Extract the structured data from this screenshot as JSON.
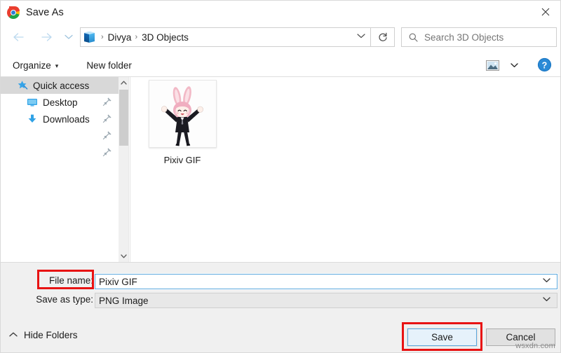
{
  "window": {
    "title": "Save As",
    "app_icon": "chrome-icon",
    "close_label": "✕"
  },
  "nav": {
    "back_icon": "arrow-left-icon",
    "forward_icon": "arrow-right-icon",
    "recent_icon": "chevron-down-icon",
    "up_icon": "arrow-up-icon",
    "breadcrumb_icon": "3d-objects-cube-icon",
    "breadcrumb": [
      "Divya",
      "3D Objects"
    ],
    "breadcrumb_separator": "›",
    "breadcrumb_dropdown_icon": "chevron-down-icon",
    "refresh_icon": "refresh-icon",
    "search_icon": "search-icon",
    "search_placeholder": "Search 3D Objects"
  },
  "toolbar": {
    "organize_label": "Organize",
    "organize_caret": "▾",
    "new_folder_label": "New folder",
    "view_icon": "view-layout-icon",
    "view_caret": "▾",
    "help_icon": "help-icon",
    "help_label": "?"
  },
  "sidebar": {
    "items": [
      {
        "label": "Quick access",
        "icon": "star-pin-icon",
        "selected": true,
        "level": 0,
        "pinned": false
      },
      {
        "label": "Desktop",
        "icon": "desktop-icon",
        "selected": false,
        "level": 1,
        "pinned": true
      },
      {
        "label": "Downloads",
        "icon": "download-icon",
        "selected": false,
        "level": 1,
        "pinned": true
      },
      {
        "label": "",
        "icon": "",
        "selected": false,
        "level": 1,
        "pinned": true
      },
      {
        "label": "",
        "icon": "",
        "selected": false,
        "level": 1,
        "pinned": true
      }
    ],
    "scroll_up_icon": "chevron-up-icon",
    "scroll_down_icon": "chevron-down-icon"
  },
  "files": [
    {
      "name": "Pixiv GIF",
      "thumbnail": "pixiv-gif-thumbnail"
    }
  ],
  "form": {
    "filename_label": "File name:",
    "filename_value": "Pixiv GIF",
    "filename_caret": "⌄",
    "filetype_label": "Save as type:",
    "filetype_value": "PNG Image",
    "filetype_caret": "⌄"
  },
  "footer": {
    "hide_folders_label": "Hide Folders",
    "hide_folders_caret": "⌃",
    "save_label": "Save",
    "cancel_label": "Cancel",
    "watermark": "wsxdn.com"
  },
  "annotations": {
    "filename_highlight": "red-box-file-name",
    "save_highlight": "red-box-save-button",
    "color": "#e81313"
  }
}
